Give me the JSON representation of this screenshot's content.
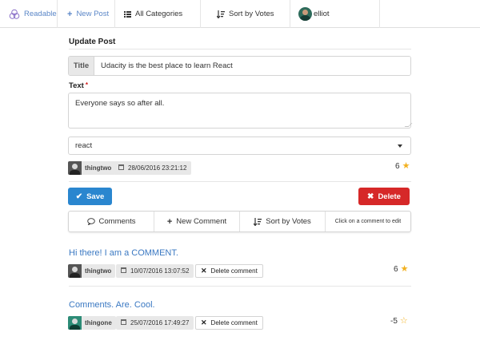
{
  "nav": {
    "brand": "Readable",
    "new_post": "New Post",
    "categories": "All Categories",
    "sort": "Sort by Votes",
    "user": "elliot"
  },
  "form": {
    "heading": "Update Post",
    "title_label": "Title",
    "title_value": "Udacity is the best place to learn React",
    "text_label": "Text",
    "required_mark": "*",
    "text_value": "Everyone says so after all.",
    "category_value": "react"
  },
  "post_meta": {
    "author": "thingtwo",
    "date": "28/06/2016 23:21:12",
    "votes": "6"
  },
  "buttons": {
    "save": "Save",
    "delete": "Delete"
  },
  "comment_toolbar": {
    "comments": "Comments",
    "new_comment": "New Comment",
    "sort": "Sort by Votes",
    "hint": "Click on a comment to edit"
  },
  "comments": [
    {
      "body": "Hi there! I am a COMMENT.",
      "author": "thingtwo",
      "date": "10/07/2016 13:07:52",
      "delete_label": "Delete comment",
      "votes": "6"
    },
    {
      "body": "Comments. Are. Cool.",
      "author": "thingone",
      "date": "25/07/2016 17:49:27",
      "delete_label": "Delete comment",
      "votes": "-5"
    }
  ],
  "colors": {
    "link": "#3a78c2",
    "primary": "#2a86cf",
    "danger": "#d62828",
    "star": "#f2b01e"
  }
}
